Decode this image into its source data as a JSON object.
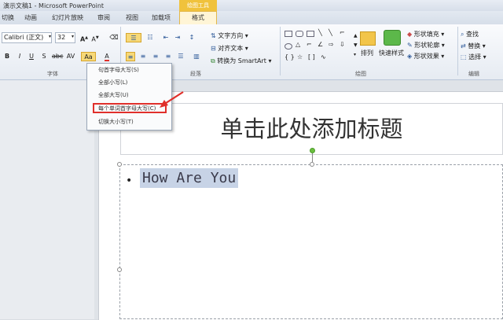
{
  "window": {
    "title": "演示文稿1 - Microsoft PowerPoint"
  },
  "tabs": {
    "items": [
      "切换",
      "动画",
      "幻灯片放映",
      "审阅",
      "视图",
      "加载项"
    ],
    "context_header": "绘图工具",
    "context_tab": "格式"
  },
  "ribbon": {
    "font": {
      "name": "Calibri (正文)",
      "size": "32",
      "group_label": "字体"
    },
    "paragraph": {
      "group_label": "段落"
    },
    "text": {
      "direction": "文字方向 ▾",
      "align": "对齐文本 ▾",
      "smartart": "转换为 SmartArt ▾"
    },
    "drawing": {
      "arrange": "排列",
      "quick_styles": "快速样式",
      "fill": "形状填充 ▾",
      "outline": "形状轮廓 ▾",
      "effects": "形状效果 ▾",
      "group_label": "绘图"
    },
    "editing": {
      "find": "查找",
      "replace": "替换 ▾",
      "select": "选择 ▾",
      "group_label": "编辑"
    }
  },
  "change_case_menu": {
    "items": [
      "句首字母大写(S)",
      "全部小写(L)",
      "全部大写(U)",
      "每个单词首字母大写(C)",
      "切换大小写(T)"
    ],
    "highlighted_index": 3
  },
  "slide": {
    "title_placeholder": "单击此处添加标题",
    "body_text": "How Are You",
    "bullet": "•"
  },
  "colors": {
    "accent": "#e0302b",
    "selection": "#c7d3e6",
    "context_tab": "#f0c23c"
  }
}
